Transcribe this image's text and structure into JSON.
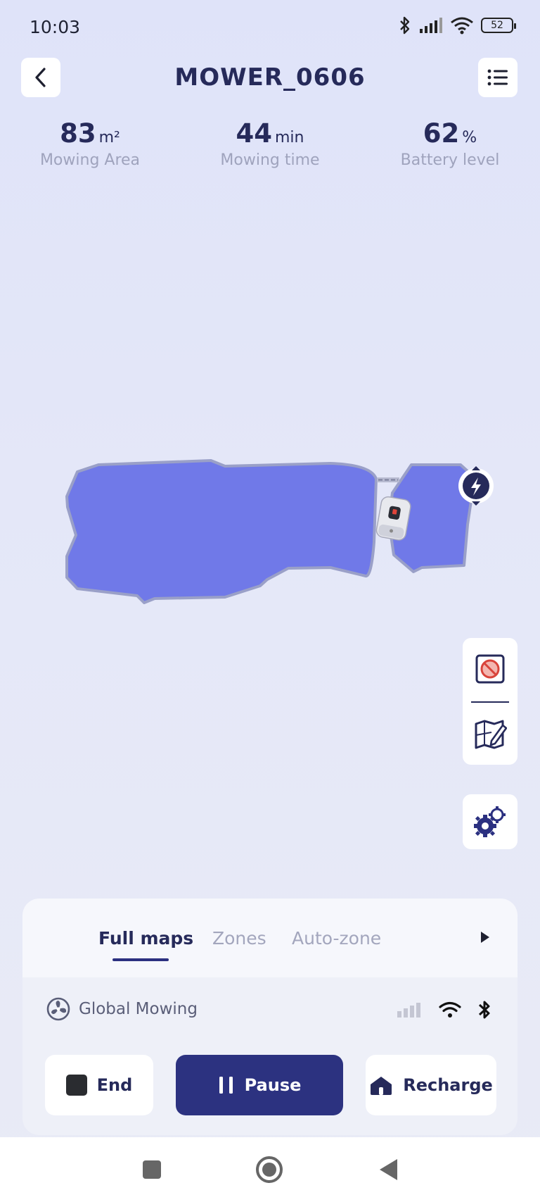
{
  "status": {
    "time": "10:03",
    "battery": "52"
  },
  "header": {
    "title": "MOWER_0606"
  },
  "stats": [
    {
      "value": "83",
      "unit": "m²",
      "label": "Mowing Area"
    },
    {
      "value": "44",
      "unit": "min",
      "label": "Mowing time"
    },
    {
      "value": "62",
      "unit": "%",
      "label": "Battery level"
    }
  ],
  "tabs": [
    {
      "label": "Full maps",
      "active": true
    },
    {
      "label": "Zones"
    },
    {
      "label": "Auto-zone"
    }
  ],
  "mode": {
    "label": "Global Mowing"
  },
  "actions": {
    "end": "End",
    "pause": "Pause",
    "recharge": "Recharge"
  },
  "colors": {
    "accent": "#2c3280",
    "lawn": "#7079e8",
    "lawn_border": "#9aa0c8",
    "text": "#262a5a",
    "muted": "#9fa3bd"
  },
  "icons": {
    "back": "chevron-left-icon",
    "menu": "list-icon",
    "no_go": "no-go-zone-icon",
    "map_edit": "map-edit-icon",
    "settings": "gears-icon",
    "charging_station": "lightning-icon",
    "mower": "mower-icon"
  }
}
